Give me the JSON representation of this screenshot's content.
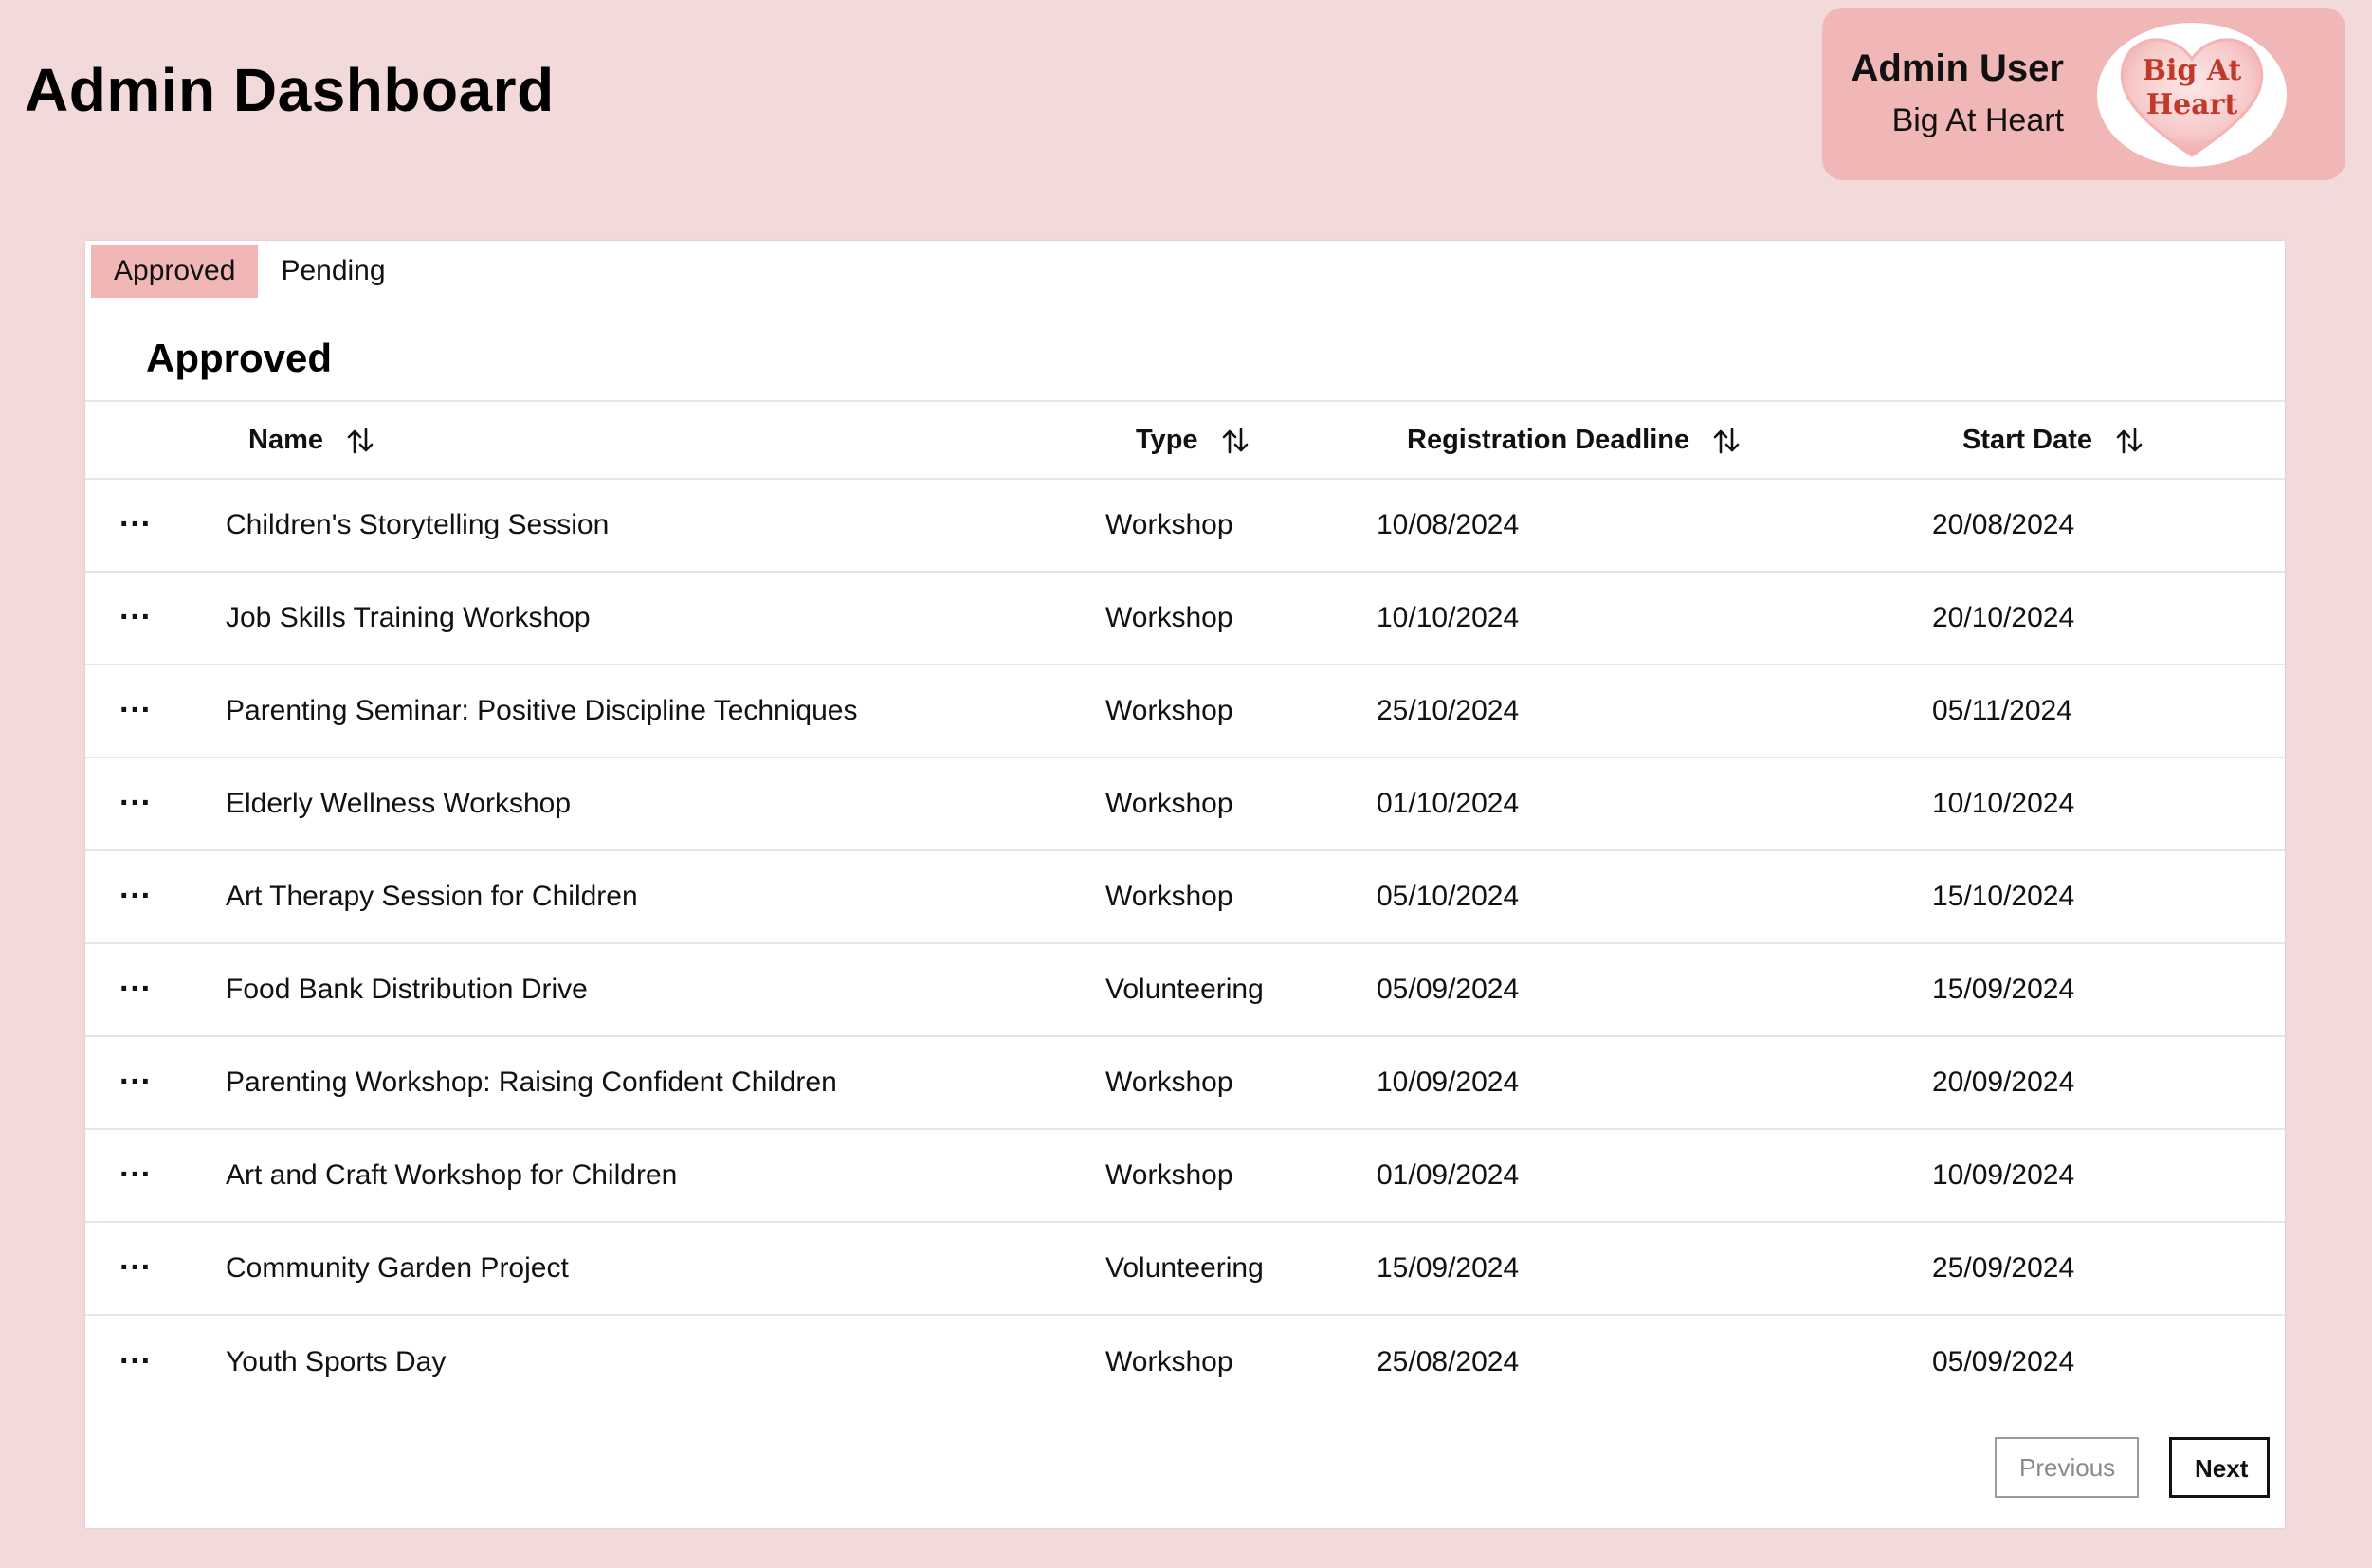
{
  "header": {
    "title": "Admin Dashboard"
  },
  "user": {
    "name": "Admin User",
    "org": "Big At Heart",
    "logo_text_line1": "Big At",
    "logo_text_line2": "Heart"
  },
  "tabs": [
    {
      "label": "Approved",
      "active": true
    },
    {
      "label": "Pending",
      "active": false
    }
  ],
  "section": {
    "title": "Approved"
  },
  "table": {
    "columns": [
      "Name",
      "Type",
      "Registration Deadline",
      "Start Date"
    ],
    "rows": [
      {
        "name": "Children's Storytelling Session",
        "type": "Workshop",
        "deadline": "10/08/2024",
        "start": "20/08/2024"
      },
      {
        "name": "Job Skills Training Workshop",
        "type": "Workshop",
        "deadline": "10/10/2024",
        "start": "20/10/2024"
      },
      {
        "name": "Parenting Seminar: Positive Discipline Techniques",
        "type": "Workshop",
        "deadline": "25/10/2024",
        "start": "05/11/2024"
      },
      {
        "name": "Elderly Wellness Workshop",
        "type": "Workshop",
        "deadline": "01/10/2024",
        "start": "10/10/2024"
      },
      {
        "name": "Art Therapy Session for Children",
        "type": "Workshop",
        "deadline": "05/10/2024",
        "start": "15/10/2024"
      },
      {
        "name": "Food Bank Distribution Drive",
        "type": "Volunteering",
        "deadline": "05/09/2024",
        "start": "15/09/2024"
      },
      {
        "name": "Parenting Workshop: Raising Confident Children",
        "type": "Workshop",
        "deadline": "10/09/2024",
        "start": "20/09/2024"
      },
      {
        "name": "Art and Craft Workshop for Children",
        "type": "Workshop",
        "deadline": "01/09/2024",
        "start": "10/09/2024"
      },
      {
        "name": "Community Garden Project",
        "type": "Volunteering",
        "deadline": "15/09/2024",
        "start": "25/09/2024"
      },
      {
        "name": "Youth Sports Day",
        "type": "Workshop",
        "deadline": "25/08/2024",
        "start": "05/09/2024"
      }
    ],
    "row_menu_glyph": "···"
  },
  "pagination": {
    "previous_label": "Previous",
    "next_label": "Next"
  },
  "icons": {
    "sort": "sort-icon",
    "row_menu": "more-horizontal-icon",
    "logo": "heart-logo-icon"
  },
  "colors": {
    "background": "#f2d9da",
    "accent": "#f1b6b6",
    "panel": "#ffffff",
    "logo_text": "#c0392b"
  }
}
